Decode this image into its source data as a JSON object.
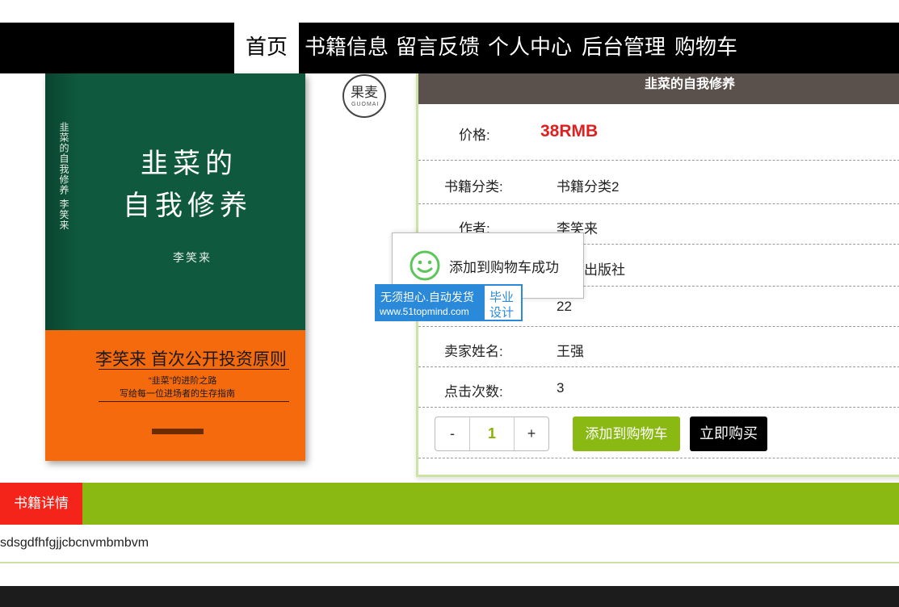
{
  "nav": {
    "items": [
      {
        "label": "首页",
        "active": true
      },
      {
        "label": "书籍信息",
        "active": false
      },
      {
        "label": "留言反馈",
        "active": false
      },
      {
        "label": "个人中心",
        "active": false
      },
      {
        "label": "后台管理",
        "active": false
      },
      {
        "label": "购物车",
        "active": false
      }
    ]
  },
  "cover": {
    "title_line1": "韭菜的",
    "title_line2": "自我修养",
    "author": "李笑来",
    "spine": "韭菜的自我修养  李笑来",
    "tagline": "李笑来 首次公开投资原则",
    "subline1": "“韭菜”的进阶之路",
    "subline2": "写给每一位进场者的生存指南",
    "publisher_logo_text": "果麦",
    "publisher_logo_sub": "GUOMAI"
  },
  "product": {
    "title": "韭菜的自我修养",
    "price_label": "价格:",
    "price": "38RMB",
    "category_label": "书籍分类:",
    "category": "书籍分类2",
    "author_label": "作者:",
    "author": "李笑来",
    "publisher_visible": "出版社",
    "stock": "22",
    "seller_label": "卖家姓名:",
    "seller": "王强",
    "clicks_label": "点击次数:",
    "clicks": "3"
  },
  "actions": {
    "minus": "-",
    "quantity": "1",
    "plus": "+",
    "add_to_cart": "添加到购物车",
    "buy_now": "立即购买"
  },
  "toast": {
    "message": "添加到购物车成功",
    "icon": "smile-icon"
  },
  "watermark": {
    "line1": "无须担心.自动发货",
    "line2": "www.51topmind.com",
    "right1": "毕业",
    "right2": "设计"
  },
  "details": {
    "tab_label": "书籍详情",
    "description": "sdsgdfhfgjjcbcnvmbmbvm"
  },
  "colors": {
    "accent_green": "#8ab913",
    "price_red": "#e02020",
    "tab_red": "#f5241a",
    "header_brown": "#5a514c"
  }
}
